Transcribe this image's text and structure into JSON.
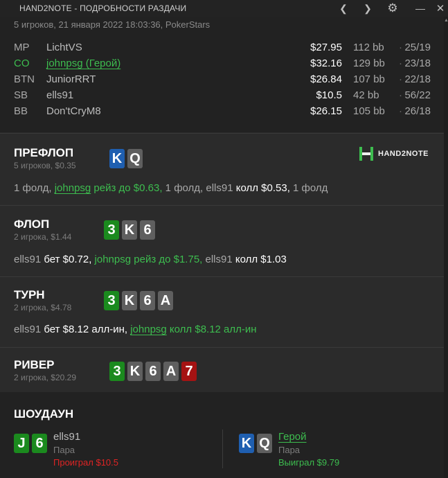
{
  "window": {
    "title": "HAND2NOTE - ПОДРОБНОСТИ РАЗДАЧИ"
  },
  "header": {
    "meta": "5 игроков, 21 января 2022 18:03:36, PokerStars",
    "players": [
      {
        "pos": "MP",
        "name": "LichtVS",
        "stack": "$27.95",
        "bb": "112 bb",
        "sep": "·",
        "stats": "25/19",
        "hero": false
      },
      {
        "pos": "CO",
        "name": "johnpsg (Герой)",
        "stack": "$32.16",
        "bb": "129 bb",
        "sep": "·",
        "stats": "23/18",
        "hero": true
      },
      {
        "pos": "BTN",
        "name": "JuniorRRT",
        "stack": "$26.84",
        "bb": "107 bb",
        "sep": "·",
        "stats": "22/18",
        "hero": false
      },
      {
        "pos": "SB",
        "name": "ells91",
        "stack": "$10.5",
        "bb": "42 bb",
        "sep": "·",
        "stats": "56/22",
        "hero": false
      },
      {
        "pos": "BB",
        "name": "Don'tCryM8",
        "stack": "$26.15",
        "bb": "105 bb",
        "sep": "·",
        "stats": "26/18",
        "hero": false
      }
    ]
  },
  "logo": {
    "text": "HAND2NOTE"
  },
  "preflop": {
    "title": "ПРЕФЛОП",
    "sub": "5 игроков, $0.35",
    "cards": [
      {
        "rank": "K",
        "color": "blue"
      },
      {
        "rank": "Q",
        "color": "gray"
      }
    ],
    "action": [
      {
        "t": "1 фолд, ",
        "c": "n"
      },
      {
        "t": "johnpsg",
        "c": "u"
      },
      {
        "t": " рейз до $0.63,",
        "c": "g"
      },
      {
        "t": " 1 фолд, ells91 ",
        "c": "n"
      },
      {
        "t": "колл $0.53,",
        "c": "w"
      },
      {
        "t": " 1 фолд",
        "c": "n"
      }
    ]
  },
  "flop": {
    "title": "ФЛОП",
    "sub": "2 игрока, $1.44",
    "cards": [
      {
        "rank": "3",
        "color": "green"
      },
      {
        "rank": "K",
        "color": "gray"
      },
      {
        "rank": "6",
        "color": "gray"
      }
    ],
    "action": [
      {
        "t": "ells91 ",
        "c": "n"
      },
      {
        "t": "бет $0.72,",
        "c": "w"
      },
      {
        "t": " johnpsg рейз до $1.75,",
        "c": "g"
      },
      {
        "t": " ells91 ",
        "c": "n"
      },
      {
        "t": "колл $1.03",
        "c": "w"
      }
    ]
  },
  "turn": {
    "title": "ТУРН",
    "sub": "2 игрока, $4.78",
    "cards": [
      {
        "rank": "3",
        "color": "green"
      },
      {
        "rank": "K",
        "color": "gray"
      },
      {
        "rank": "6",
        "color": "gray"
      },
      {
        "rank": "A",
        "color": "gray"
      }
    ],
    "action": [
      {
        "t": "ells91 ",
        "c": "n"
      },
      {
        "t": "бет $8.12 алл-ин,",
        "c": "w"
      },
      {
        "t": " ",
        "c": "n"
      },
      {
        "t": "johnpsg",
        "c": "u"
      },
      {
        "t": " колл $8.12 алл-ин",
        "c": "g"
      }
    ]
  },
  "river": {
    "title": "РИВЕР",
    "sub": "2 игрока, $20.29",
    "cards": [
      {
        "rank": "3",
        "color": "green"
      },
      {
        "rank": "K",
        "color": "gray"
      },
      {
        "rank": "6",
        "color": "gray"
      },
      {
        "rank": "A",
        "color": "gray"
      },
      {
        "rank": "7",
        "color": "red"
      }
    ]
  },
  "showdown": {
    "title": "ШОУДАУН",
    "left": {
      "cards": [
        {
          "rank": "J",
          "color": "green"
        },
        {
          "rank": "6",
          "color": "green"
        }
      ],
      "name": "ells91",
      "hand": "Пара",
      "result": "Проиграл $10.5",
      "result_color": "#e02424"
    },
    "right": {
      "cards": [
        {
          "rank": "K",
          "color": "blue"
        },
        {
          "rank": "Q",
          "color": "gray"
        }
      ],
      "name": "Герой",
      "hand": "Пара",
      "result": "Выиграл $9.79",
      "result_color": "#3dbd4f"
    }
  },
  "colors": {
    "green": "#3dbd4f",
    "white": "#ffffff",
    "muted": "#a9a9a9",
    "lose": "#e02424"
  }
}
